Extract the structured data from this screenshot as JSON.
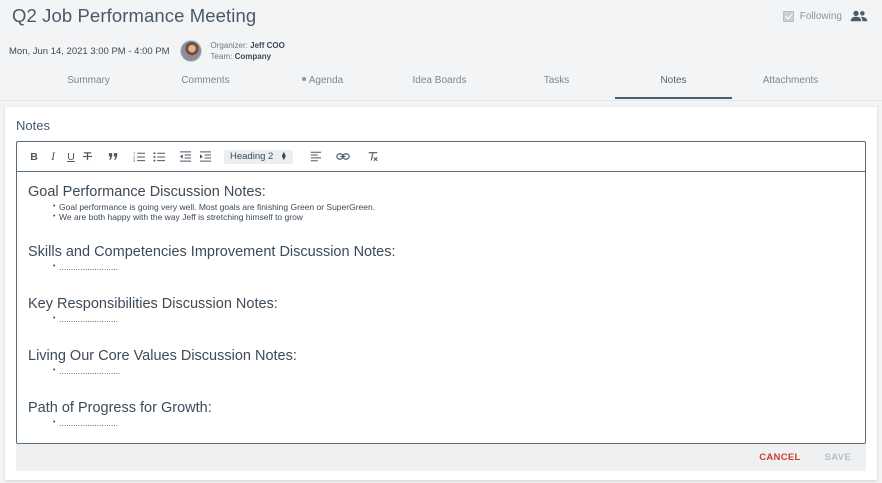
{
  "meeting": {
    "title": "Q2 Job Performance Meeting",
    "datetime": "Mon, Jun 14, 2021 3:00 PM - 4:00 PM",
    "organizer_label": "Organizer:",
    "organizer": "Jeff COO",
    "team_label": "Team:",
    "team": "Company",
    "following_label": "Following",
    "following_checked": true
  },
  "tabs": [
    {
      "label": "Summary"
    },
    {
      "label": "Comments"
    },
    {
      "label": "Agenda",
      "dot": true
    },
    {
      "label": "Idea Boards"
    },
    {
      "label": "Tasks"
    },
    {
      "label": "Notes",
      "active": true
    },
    {
      "label": "Attachments"
    }
  ],
  "notes": {
    "title": "Notes",
    "heading_select": "Heading 2",
    "sections": [
      {
        "heading": "Goal Performance Discussion Notes:",
        "bullets": [
          "Goal performance is going very well.  Most goals are finishing Green or SuperGreen.",
          "We are both happy with the way Jeff is stretching himself to grow"
        ]
      },
      {
        "heading": "Skills and Competencies Improvement Discussion Notes:",
        "bullets": [
          "........................."
        ]
      },
      {
        "heading": "Key Responsibilities Discussion Notes:",
        "bullets": [
          "........................."
        ]
      },
      {
        "heading": "Living Our Core Values Discussion Notes:",
        "bullets": ".........................."
      },
      {
        "heading": "Path of Progress for Growth:",
        "bullets": [
          "........................."
        ]
      }
    ]
  },
  "footer": {
    "cancel": "CANCEL",
    "save": "SAVE"
  },
  "colors": {
    "accent": "#4b5d6d",
    "cancel": "#c9402f",
    "disabled": "#b7bec4"
  }
}
